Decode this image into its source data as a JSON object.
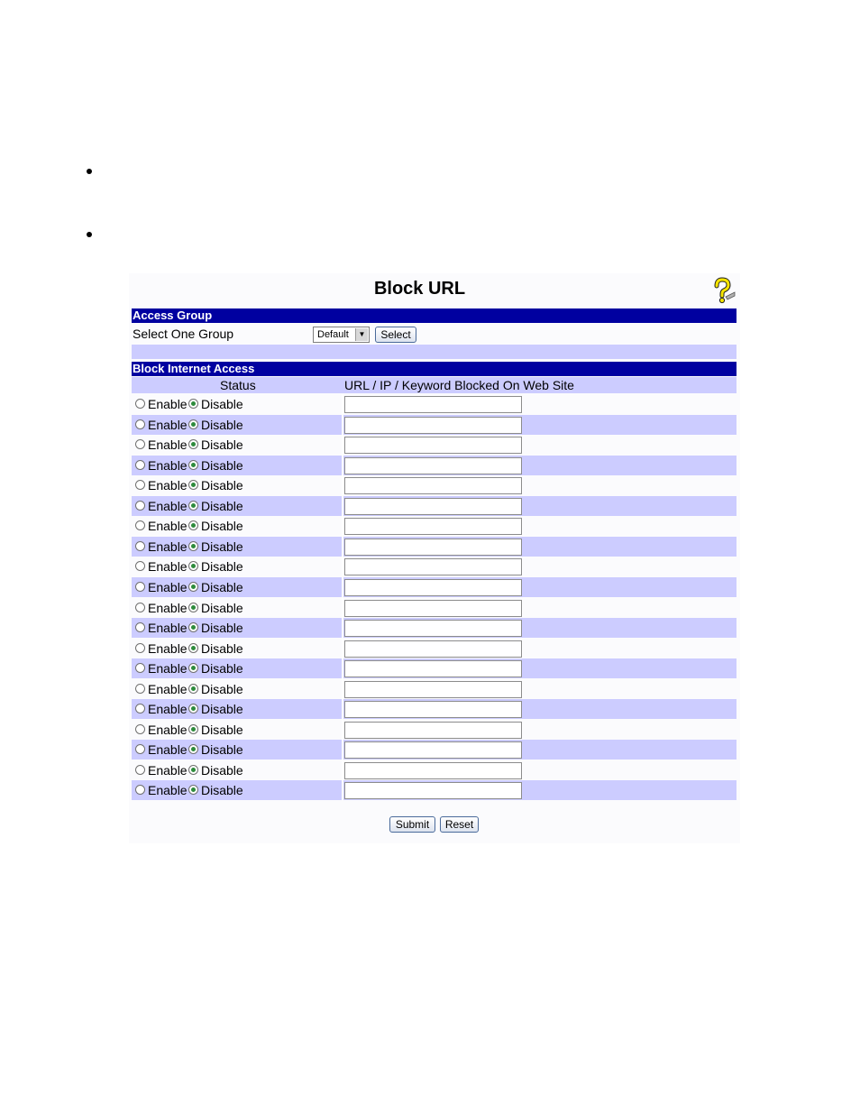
{
  "page": {
    "title": "Block URL",
    "help_icon": "help-question-icon"
  },
  "access_group": {
    "header": "Access Group",
    "select_label": "Select One Group",
    "group_value": "Default",
    "select_button": "Select"
  },
  "block_access": {
    "header": "Block Internet Access",
    "status_col": "Status",
    "url_col": "URL / IP / Keyword Blocked On Web Site",
    "enable_label": "Enable",
    "disable_label": "Disable",
    "rows": [
      {
        "enabled": false,
        "url": ""
      },
      {
        "enabled": false,
        "url": ""
      },
      {
        "enabled": false,
        "url": ""
      },
      {
        "enabled": false,
        "url": ""
      },
      {
        "enabled": false,
        "url": ""
      },
      {
        "enabled": false,
        "url": ""
      },
      {
        "enabled": false,
        "url": ""
      },
      {
        "enabled": false,
        "url": ""
      },
      {
        "enabled": false,
        "url": ""
      },
      {
        "enabled": false,
        "url": ""
      },
      {
        "enabled": false,
        "url": ""
      },
      {
        "enabled": false,
        "url": ""
      },
      {
        "enabled": false,
        "url": ""
      },
      {
        "enabled": false,
        "url": ""
      },
      {
        "enabled": false,
        "url": ""
      },
      {
        "enabled": false,
        "url": ""
      },
      {
        "enabled": false,
        "url": ""
      },
      {
        "enabled": false,
        "url": ""
      },
      {
        "enabled": false,
        "url": ""
      },
      {
        "enabled": false,
        "url": ""
      }
    ]
  },
  "actions": {
    "submit": "Submit",
    "reset": "Reset"
  },
  "colors": {
    "header_bg": "#0000a0",
    "band_bg": "#ccccff",
    "radio_selected": "#2e8b3c"
  }
}
